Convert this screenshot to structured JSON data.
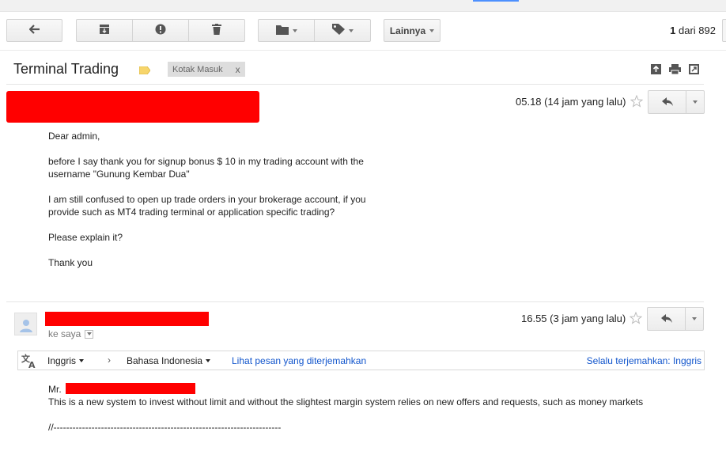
{
  "toolbar": {
    "more_label": "Lainnya",
    "pager_current": "1",
    "pager_sep": "dari",
    "pager_total": "892"
  },
  "icons": {
    "back": "arrow-back-icon",
    "archive": "archive-icon",
    "spam": "report-spam-icon",
    "delete": "trash-icon",
    "move": "folder-icon",
    "labels": "tag-icon",
    "star": "star-icon",
    "reply": "reply-icon",
    "translate": "translate-icon",
    "avatar": "person-icon"
  },
  "thread": {
    "subject": "Terminal Trading",
    "inbox_chip": "Kotak Masuk",
    "inbox_chip_remove": "x"
  },
  "message1": {
    "time": "05.18 (14 jam yang lalu)",
    "paragraphs": [
      "Dear admin,",
      "before I say thank you for signup bonus $ 10 in my trading account with the username \"Gunung Kembar Dua\"",
      "I am still confused to open up trade orders in your brokerage account, if you provide such as MT4 trading terminal or application specific trading?",
      "Please explain it?",
      "Thank you"
    ]
  },
  "message2": {
    "time": "16.55 (3 jam yang lalu)",
    "to": "ke saya",
    "translate": {
      "source_lang": "Inggris",
      "arrow": "›",
      "target_lang": "Bahasa Indonesia",
      "view_link": "Lihat pesan yang diterjemahkan",
      "always_link": "Selalu terjemahkan: Inggris"
    },
    "salutation": "Mr.",
    "line1": "This is a new system to invest without limit and without the slightest margin system relies on new offers and requests, such as money markets",
    "divider": "//------------------------------------------------------------------------"
  },
  "colors": {
    "link": "#1155cc",
    "redaction": "#ff0000",
    "label_tag": "#f7d56b"
  }
}
